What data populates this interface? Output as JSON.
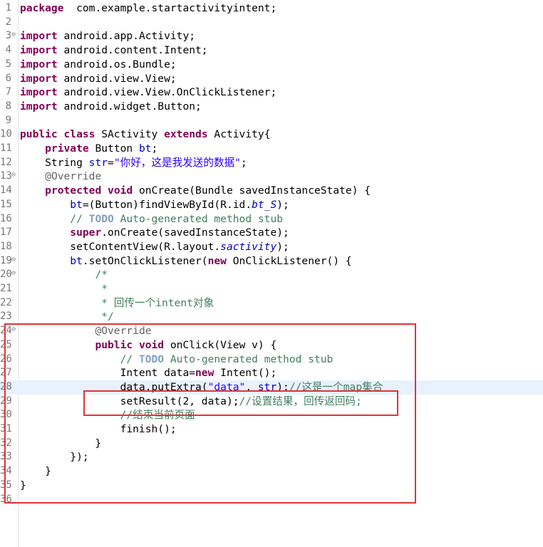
{
  "editor": {
    "lines": [
      {
        "n": "1",
        "fold": "",
        "segs": [
          [
            "kw",
            "package"
          ],
          [
            "",
            "  com.example.startactivityintent;"
          ]
        ]
      },
      {
        "n": "2",
        "fold": "",
        "segs": []
      },
      {
        "n": "3",
        "fold": "⊖",
        "segs": [
          [
            "kw",
            "import"
          ],
          [
            "",
            " android.app.Activity;"
          ]
        ]
      },
      {
        "n": "4",
        "fold": "",
        "segs": [
          [
            "kw",
            "import"
          ],
          [
            "",
            " android.content.Intent;"
          ]
        ]
      },
      {
        "n": "5",
        "fold": "",
        "segs": [
          [
            "kw",
            "import"
          ],
          [
            "",
            " android.os.Bundle;"
          ]
        ]
      },
      {
        "n": "6",
        "fold": "",
        "segs": [
          [
            "kw",
            "import"
          ],
          [
            "",
            " android.view.View;"
          ]
        ]
      },
      {
        "n": "7",
        "fold": "",
        "segs": [
          [
            "kw",
            "import"
          ],
          [
            "",
            " android.view.View.OnClickListener;"
          ]
        ]
      },
      {
        "n": "8",
        "fold": "",
        "segs": [
          [
            "kw",
            "import"
          ],
          [
            "",
            " android.widget.Button;"
          ]
        ]
      },
      {
        "n": "9",
        "fold": "",
        "segs": []
      },
      {
        "n": "10",
        "fold": "",
        "segs": [
          [
            "kw",
            "public"
          ],
          [
            "",
            " "
          ],
          [
            "kw",
            "class"
          ],
          [
            "",
            " SActivity "
          ],
          [
            "kw",
            "extends"
          ],
          [
            "",
            " Activity{"
          ]
        ]
      },
      {
        "n": "11",
        "fold": "",
        "segs": [
          [
            "",
            "    "
          ],
          [
            "kw",
            "private"
          ],
          [
            "",
            " Button "
          ],
          [
            "fld",
            "bt"
          ],
          [
            "",
            ";"
          ]
        ]
      },
      {
        "n": "12",
        "fold": "",
        "segs": [
          [
            "",
            "    String "
          ],
          [
            "fld",
            "str"
          ],
          [
            "",
            "="
          ],
          [
            "str",
            "\"你好，这是我发送的数据\""
          ],
          [
            "",
            ";"
          ]
        ]
      },
      {
        "n": "13",
        "fold": "⊖",
        "segs": [
          [
            "",
            "    "
          ],
          [
            "ann",
            "@Override"
          ]
        ]
      },
      {
        "n": "14",
        "fold": "",
        "segs": [
          [
            "",
            "    "
          ],
          [
            "kw",
            "protected"
          ],
          [
            "",
            " "
          ],
          [
            "kw",
            "void"
          ],
          [
            "",
            " onCreate(Bundle savedInstanceState) {"
          ]
        ]
      },
      {
        "n": "15",
        "fold": "",
        "segs": [
          [
            "",
            "        "
          ],
          [
            "fld",
            "bt"
          ],
          [
            "",
            "=(Button)findViewById(R.id."
          ],
          [
            "sfld",
            "bt_S"
          ],
          [
            "",
            ");"
          ]
        ]
      },
      {
        "n": "16",
        "fold": "",
        "segs": [
          [
            "",
            "        "
          ],
          [
            "cmt",
            "// "
          ],
          [
            "todo",
            "TODO"
          ],
          [
            "cmt",
            " Auto-generated method stub"
          ]
        ]
      },
      {
        "n": "17",
        "fold": "",
        "segs": [
          [
            "",
            "        "
          ],
          [
            "kw",
            "super"
          ],
          [
            "",
            ".onCreate(savedInstanceState);"
          ]
        ]
      },
      {
        "n": "18",
        "fold": "",
        "segs": [
          [
            "",
            "        setContentView(R.layout."
          ],
          [
            "sfld",
            "sactivity"
          ],
          [
            "",
            ");"
          ]
        ]
      },
      {
        "n": "19",
        "fold": "⊖",
        "segs": [
          [
            "",
            "        "
          ],
          [
            "fld",
            "bt"
          ],
          [
            "",
            ".setOnClickListener("
          ],
          [
            "kw",
            "new"
          ],
          [
            "",
            " OnClickListener() {"
          ]
        ]
      },
      {
        "n": "20",
        "fold": "⊖",
        "segs": [
          [
            "",
            "            "
          ],
          [
            "cmt",
            "/*"
          ]
        ]
      },
      {
        "n": "21",
        "fold": "",
        "segs": [
          [
            "",
            "             "
          ],
          [
            "cmt",
            "*"
          ]
        ]
      },
      {
        "n": "22",
        "fold": "",
        "segs": [
          [
            "",
            "             "
          ],
          [
            "cmt",
            "* 回传一个intent对象"
          ]
        ]
      },
      {
        "n": "23",
        "fold": "",
        "segs": [
          [
            "",
            "             "
          ],
          [
            "cmt",
            "*/"
          ]
        ]
      },
      {
        "n": "24",
        "fold": "⊖",
        "segs": [
          [
            "",
            "            "
          ],
          [
            "ann",
            "@Override"
          ]
        ]
      },
      {
        "n": "25",
        "fold": "",
        "segs": [
          [
            "",
            "            "
          ],
          [
            "kw",
            "public"
          ],
          [
            "",
            " "
          ],
          [
            "kw",
            "void"
          ],
          [
            "",
            " onClick(View v) {"
          ]
        ]
      },
      {
        "n": "26",
        "fold": "",
        "segs": [
          [
            "",
            "                "
          ],
          [
            "cmt",
            "// "
          ],
          [
            "todo",
            "TODO"
          ],
          [
            "cmt",
            " Auto-generated method stub"
          ]
        ]
      },
      {
        "n": "27",
        "fold": "",
        "segs": [
          [
            "",
            "                Intent data="
          ],
          [
            "kw",
            "new"
          ],
          [
            "",
            " Intent();"
          ]
        ]
      },
      {
        "n": "28",
        "fold": "",
        "segs": [
          [
            "",
            "                data.putExtra("
          ],
          [
            "str",
            "\"data\""
          ],
          [
            "",
            ", "
          ],
          [
            "fld",
            "str"
          ],
          [
            "",
            ");"
          ],
          [
            "cmt",
            "//这是一个map集合"
          ]
        ]
      },
      {
        "n": "29",
        "fold": "",
        "segs": [
          [
            "",
            "                setResult(2, data);"
          ],
          [
            "cmt",
            "//设置结果，回传返回码;"
          ]
        ]
      },
      {
        "n": "30",
        "fold": "",
        "segs": [
          [
            "",
            "                "
          ],
          [
            "cmt",
            "//结束当前页面"
          ]
        ]
      },
      {
        "n": "31",
        "fold": "",
        "segs": [
          [
            "",
            "                finish();"
          ]
        ]
      },
      {
        "n": "32",
        "fold": "",
        "segs": [
          [
            "",
            "            }"
          ]
        ]
      },
      {
        "n": "33",
        "fold": "",
        "segs": [
          [
            "",
            "        });"
          ]
        ]
      },
      {
        "n": "34",
        "fold": "",
        "segs": [
          [
            "",
            "    }"
          ]
        ]
      },
      {
        "n": "35",
        "fold": "",
        "segs": [
          [
            "",
            "}"
          ]
        ]
      },
      {
        "n": "36",
        "fold": "",
        "segs": []
      }
    ],
    "current_line": "28"
  },
  "colors": {
    "keyword": "#7f0055",
    "string": "#2a00ff",
    "comment": "#3f7f5f",
    "todo": "#7f9fbf",
    "annotation": "#646464",
    "field": "#0000c0",
    "highlight_box": "#e0333b",
    "current_line_bg": "#e8f2fe"
  },
  "icons": {
    "fold_marker": "collapse-fold-icon"
  }
}
